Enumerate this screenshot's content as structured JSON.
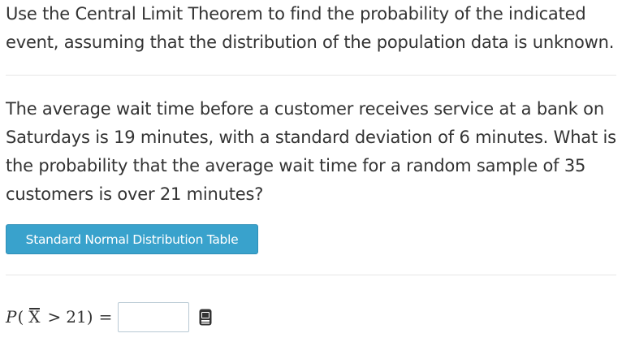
{
  "instructions": {
    "line1": "Use the Central Limit Theorem to find the probability of the indicated",
    "line2": "event, assuming that the distribution of the population data is unknown."
  },
  "question": {
    "line1": "The average wait time before a customer receives service at a bank on",
    "line2": "Saturdays is 19 minutes, with a standard deviation of 6 minutes. What is",
    "line3": "the probability that the average wait time for a random sample of 35",
    "line4": "customers is over 21 minutes?"
  },
  "table_button": {
    "label": "Standard Normal Distribution Table"
  },
  "answer": {
    "p_symbol": "P",
    "open_paren": "(",
    "xbar": "X",
    "operator": ">",
    "threshold": "21",
    "close_paren": ")",
    "equals": "=",
    "input_value": "",
    "input_placeholder": ""
  },
  "icons": {
    "keyboard": "keyboard-icon"
  },
  "colors": {
    "button_bg": "#39a2cc",
    "text": "#333333",
    "divider": "#e6e6e6",
    "input_border": "#b8c9d4"
  }
}
